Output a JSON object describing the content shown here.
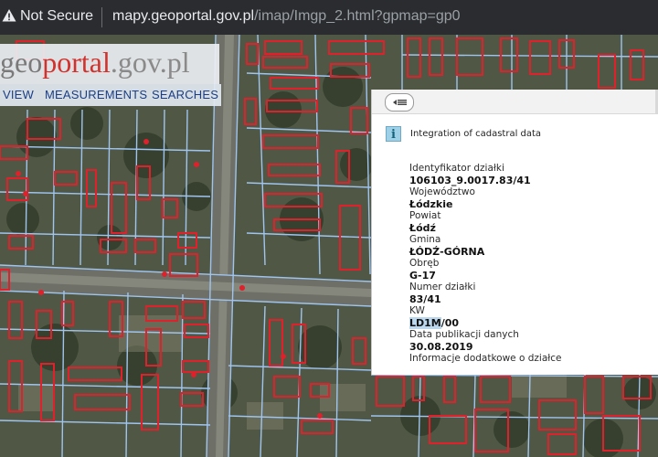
{
  "browser": {
    "security_label": "Not Secure",
    "url_host": "mapy.geoportal.gov.pl",
    "url_path": "/imap/Imgp_2.html?gpmap=gp0"
  },
  "logo": {
    "part1": "geo",
    "part2": "portal",
    "part3": ".gov.pl"
  },
  "menu": {
    "view": "VIEW",
    "measurements": "MEASUREMENTS",
    "searches": "SEARCHES"
  },
  "panel": {
    "title": "Integration of cadastral data",
    "rows": [
      {
        "label": "Identyfikator działki",
        "value": "106103_9.0017.83/41"
      },
      {
        "label": "Województwo",
        "value": "Łódzkie"
      },
      {
        "label": "Powiat",
        "value": "Łódź"
      },
      {
        "label": "Gmina",
        "value": "ŁÓDŹ-GÓRNA"
      },
      {
        "label": "Obręb",
        "value": "G-17"
      },
      {
        "label": "Numer działki",
        "value": "83/41"
      },
      {
        "label": "KW",
        "value_highlight": "LD1M",
        "value_rest": "/00"
      },
      {
        "label": "Data publikacji danych",
        "value": "30.08.2019"
      },
      {
        "label": "Informacje dodatkowe o działce",
        "value": ""
      }
    ]
  },
  "colors": {
    "building_outline": "#e0202a",
    "parcel_line": "#9fc4ef",
    "info_icon_bg": "#9ed1e8",
    "menu_text": "#1b3e86"
  }
}
